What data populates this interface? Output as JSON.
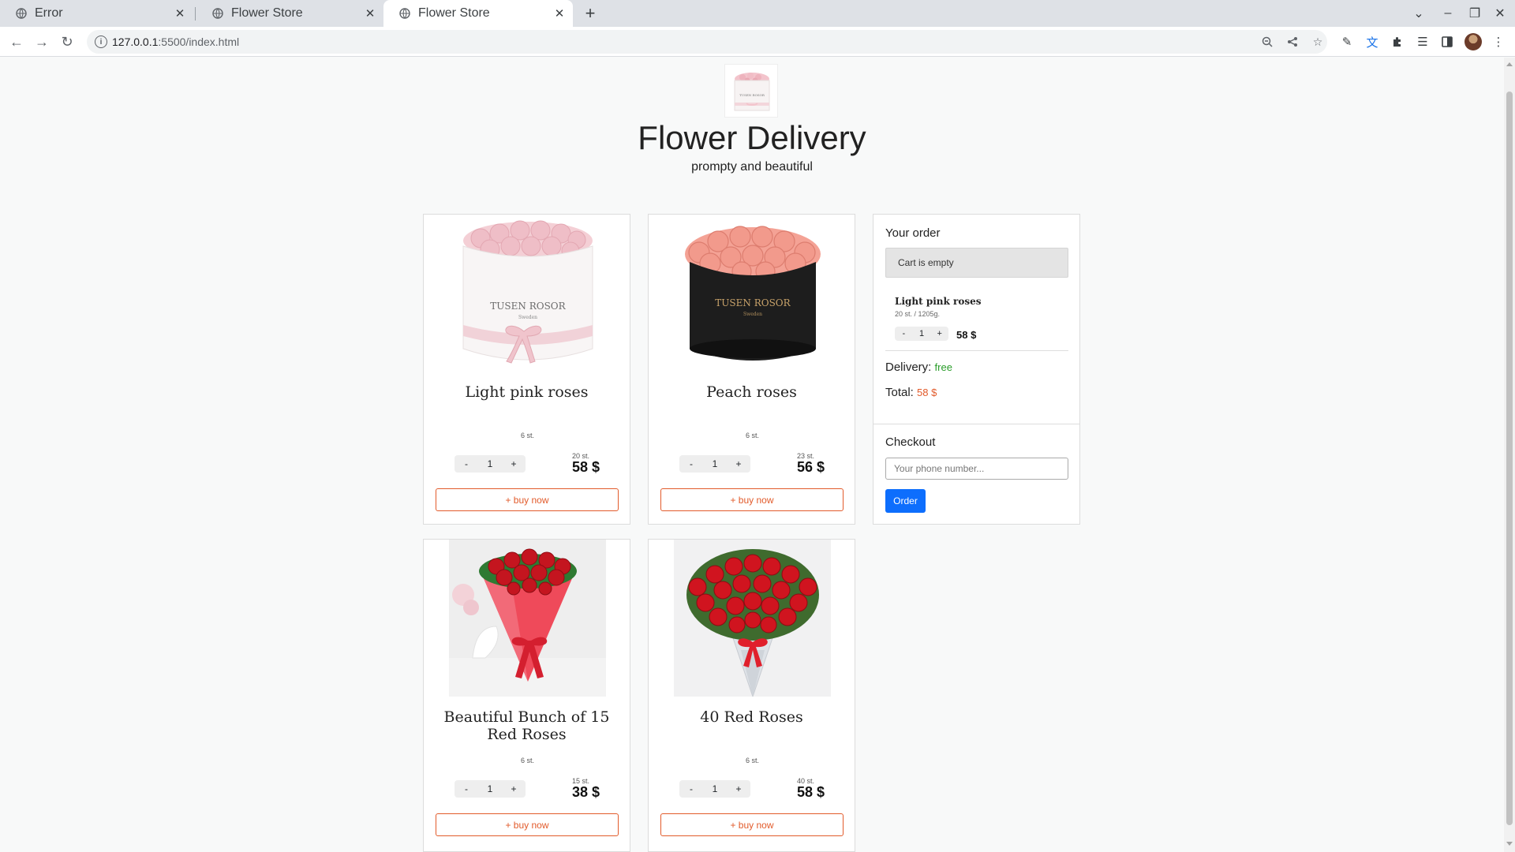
{
  "browser": {
    "tabs": [
      {
        "title": "Error"
      },
      {
        "title": "Flower Store"
      },
      {
        "title": "Flower Store"
      }
    ],
    "url_host": "127.0.0.1",
    "url_path": ":5500/index.html"
  },
  "header": {
    "title": "Flower Delivery",
    "subtitle": "prompty and beautiful"
  },
  "products": [
    {
      "name": "Light pink roses",
      "stock": "6 st.",
      "quantity": "1",
      "count": "20 st.",
      "price": "58 $",
      "buy_label": "+ buy now",
      "minus": "-",
      "plus": "+"
    },
    {
      "name": "Peach roses",
      "stock": "6 st.",
      "quantity": "1",
      "count": "23 st.",
      "price": "56 $",
      "buy_label": "+ buy now",
      "minus": "-",
      "plus": "+"
    },
    {
      "name": "Beautiful Bunch of 15 Red Roses",
      "stock": "6 st.",
      "quantity": "1",
      "count": "15 st.",
      "price": "38 $",
      "buy_label": "+ buy now",
      "minus": "-",
      "plus": "+"
    },
    {
      "name": "40 Red Roses",
      "stock": "6 st.",
      "quantity": "1",
      "count": "40 st.",
      "price": "58 $",
      "buy_label": "+ buy now",
      "minus": "-",
      "plus": "+"
    }
  ],
  "order": {
    "heading": "Your order",
    "empty_label": "Cart is empty",
    "item": {
      "name": "Light pink roses",
      "meta": "20 st. / 1205g.",
      "quantity": "1",
      "minus": "-",
      "plus": "+",
      "price": "58 $"
    },
    "delivery_label": "Delivery:",
    "delivery_value": "free",
    "total_label": "Total:",
    "total_value": "58 $",
    "checkout_heading": "Checkout",
    "phone_placeholder": "Your phone number...",
    "order_button": "Order"
  },
  "colors": {
    "accent": "#e25b2b",
    "free": "#2a9d2a",
    "total": "#e25b2b",
    "order_button": "#0d6efd"
  }
}
